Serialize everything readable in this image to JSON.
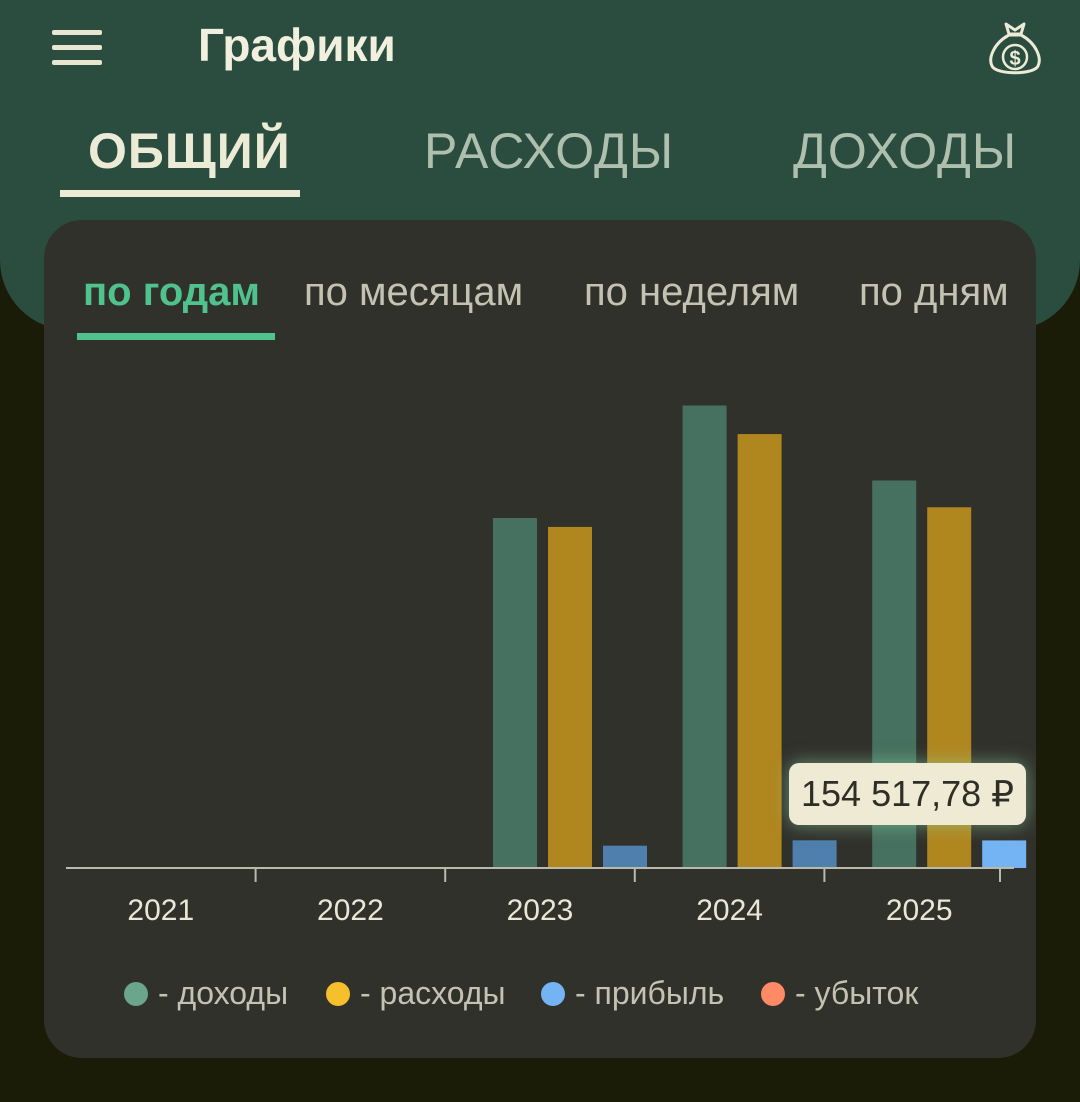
{
  "header": {
    "title": "Графики",
    "menu_icon": "hamburger-menu-icon",
    "money_icon": "money-bag-icon"
  },
  "tabs": [
    {
      "label": "ОБЩИЙ",
      "active": true
    },
    {
      "label": "РАСХОДЫ",
      "active": false
    },
    {
      "label": "ДОХОДЫ",
      "active": false
    }
  ],
  "period_tabs": [
    {
      "label": "по годам",
      "active": true
    },
    {
      "label": "по месяцам",
      "active": false
    },
    {
      "label": "по неделям",
      "active": false
    },
    {
      "label": "по дням",
      "active": false
    }
  ],
  "tooltip": {
    "text": "154 517,78 ₽"
  },
  "colors": {
    "income": "#46705f",
    "expense": "#b0861f",
    "profit": "#4f7fad",
    "profit_selected": "#74b4f4",
    "loss": "#ff8a65",
    "legend_income": "#6aa58c",
    "legend_expense": "#f5c02c",
    "legend_profit": "#74b4f4",
    "legend_loss": "#ff8a65",
    "axis": "#b9b9ac"
  },
  "chart_data": {
    "type": "bar",
    "categories": [
      "2021",
      "2022",
      "2023",
      "2024",
      "2025"
    ],
    "series": [
      {
        "name": "- доходы",
        "key": "income",
        "values": [
          0,
          0,
          1960000,
          2590000,
          2170000
        ]
      },
      {
        "name": "- расходы",
        "key": "expense",
        "values": [
          0,
          0,
          1910000,
          2430000,
          2020000
        ]
      },
      {
        "name": "- прибыль",
        "key": "profit",
        "values": [
          0,
          0,
          125000,
          155000,
          154517.78
        ]
      },
      {
        "name": "- убыток",
        "key": "loss",
        "values": [
          0,
          0,
          0,
          0,
          0
        ]
      }
    ],
    "selected": {
      "series": "profit",
      "category": "2025"
    },
    "ylim": [
      0,
      2800000
    ],
    "grid": false,
    "legend": "bottom"
  }
}
